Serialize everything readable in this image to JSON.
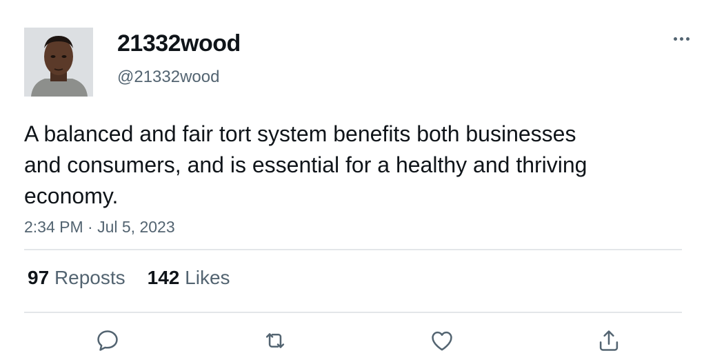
{
  "tweet": {
    "display_name": "21332wood",
    "handle": "@21332wood",
    "text": "A balanced and fair tort system benefits both businesses and consumers, and is essential for a healthy and thriving economy.",
    "timestamp": "2:34 PM · Jul 5, 2023"
  },
  "stats": {
    "reposts_count": "97",
    "reposts_label": "Reposts",
    "likes_count": "142",
    "likes_label": "Likes"
  },
  "icons": {
    "more": "more-horizontal-icon",
    "reply": "reply-icon",
    "repost": "repost-icon",
    "like": "heart-icon",
    "share": "share-icon"
  },
  "colors": {
    "text": "#0f1419",
    "secondary": "#536471",
    "divider": "#e3e6e9"
  }
}
